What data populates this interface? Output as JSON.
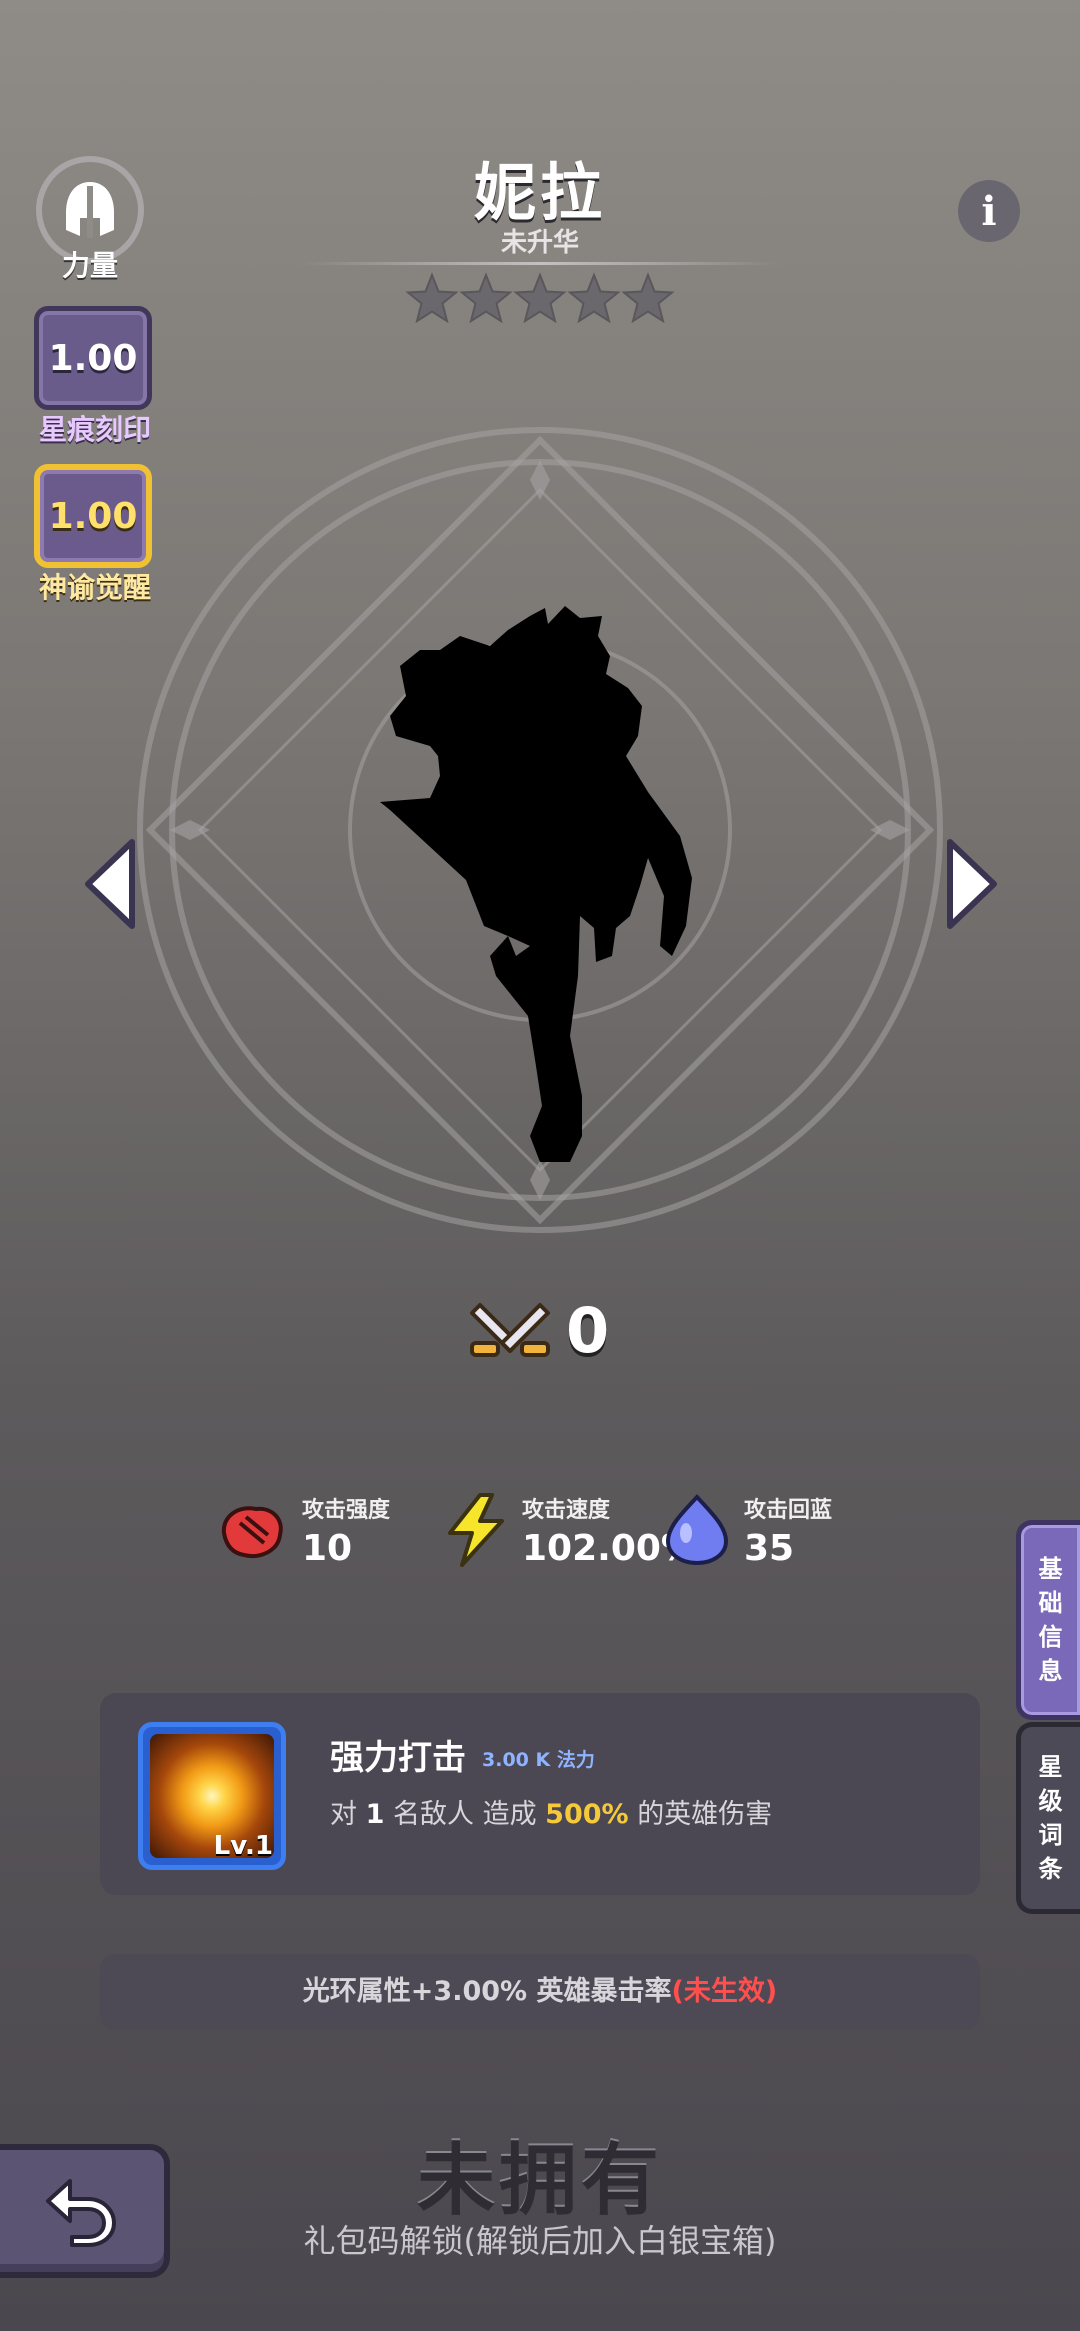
{
  "hero": {
    "name": "妮拉",
    "ascension_status": "未升华",
    "stars_filled": 0,
    "stars_total": 5
  },
  "left_panel": {
    "class_label": "力量",
    "star_mark": {
      "value": "1.00",
      "label": "星痕刻印"
    },
    "oracle_awaken": {
      "value": "1.00",
      "label": "神谕觉醒"
    }
  },
  "power": {
    "value": "0"
  },
  "stats": [
    {
      "label": "攻击强度",
      "value": "10",
      "icon": "fist-icon"
    },
    {
      "label": "攻击速度",
      "value": "102.00%",
      "icon": "lightning-icon"
    },
    {
      "label": "攻击回蓝",
      "value": "35",
      "icon": "mana-drop-icon"
    }
  ],
  "skill": {
    "name": "强力打击",
    "cost": "3.00 K 法力",
    "level": "Lv.1",
    "desc_prefix": "对",
    "desc_count": "1",
    "desc_mid": "名敌人 造成",
    "desc_percent": "500%",
    "desc_suffix": "的英雄伤害"
  },
  "aura": {
    "text": "光环属性+3.00% 英雄暴击率",
    "status": "(未生效)"
  },
  "side_tabs": [
    {
      "label": "基础信息",
      "active": true
    },
    {
      "label": "星级词条",
      "active": false
    }
  ],
  "footer": {
    "owned_status": "未拥有",
    "unlock_hint": "礼包码解锁(解锁后加入白银宝箱)"
  },
  "colors": {
    "accent_purple": "#7a68b8",
    "gold": "#f0c233",
    "highlight_yellow": "#f6c93a",
    "inactive_red": "#ff4f4f",
    "mana_blue": "#8fb3ff"
  }
}
